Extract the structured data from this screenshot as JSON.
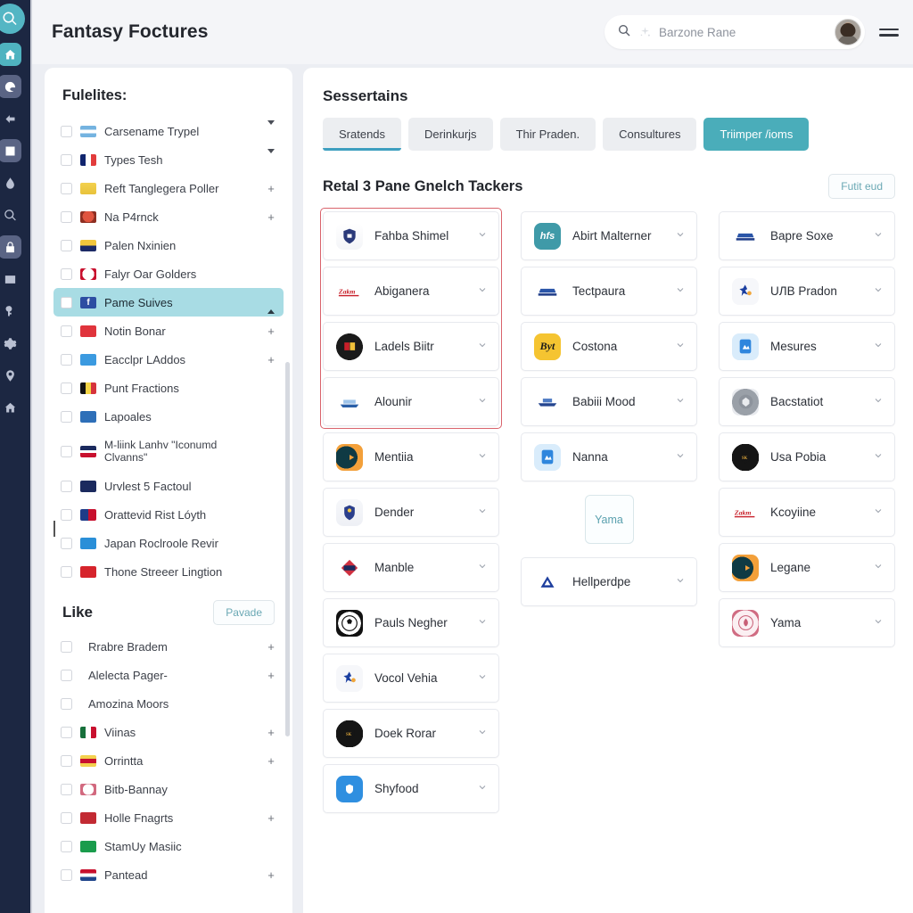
{
  "header": {
    "title": "Fantasy Foctures",
    "search": {
      "value": "Barzone Rane",
      "icon": "search-icon",
      "sparkle_icon": "sparkle-icon"
    },
    "avatar_label": "user-avatar",
    "menu_label": "menu-icon"
  },
  "rail": {
    "items": [
      {
        "name": "search-circle-icon",
        "glyph": "search",
        "style": "accent"
      },
      {
        "name": "home-chip-icon",
        "glyph": "home",
        "style": "chip"
      },
      {
        "name": "edge-icon",
        "glyph": "edge",
        "style": "plain"
      },
      {
        "name": "back-arrow-icon",
        "glyph": "arrow-left",
        "style": "plain"
      },
      {
        "name": "app-window-icon",
        "glyph": "window",
        "style": "plain"
      },
      {
        "name": "droplet-icon",
        "glyph": "droplet",
        "style": "plain"
      },
      {
        "name": "magnifier-icon",
        "glyph": "search",
        "style": "plain"
      },
      {
        "name": "lock-chip-icon",
        "glyph": "lock",
        "style": "chip3"
      },
      {
        "name": "card-icon",
        "glyph": "card",
        "style": "plain"
      },
      {
        "name": "key-icon",
        "glyph": "key",
        "style": "plain"
      },
      {
        "name": "gear-icon",
        "glyph": "gear",
        "style": "plain"
      },
      {
        "name": "pin-icon",
        "glyph": "pin",
        "style": "plain"
      },
      {
        "name": "house-icon",
        "glyph": "house",
        "style": "plain"
      }
    ]
  },
  "left_panel": {
    "title": "Fulelites:",
    "items": [
      {
        "label": "Carsename Trypel",
        "end": "caret-down",
        "flag": "ar"
      },
      {
        "label": "Types Tesh",
        "end": "caret-down",
        "flag": "fr"
      },
      {
        "label": "Reft Tanglegera Poller",
        "end": "+",
        "flag": "badge-gold"
      },
      {
        "label": "Na P4rnck",
        "end": "+",
        "flag": "crest-red"
      },
      {
        "label": "Palen Nxinien",
        "end": "",
        "flag": "ua"
      },
      {
        "label": "Falyr Oar Golders",
        "end": "",
        "flag": "crest-white"
      },
      {
        "label": "Pame Suives",
        "end": "caret-up",
        "flag": "fb",
        "selected": true
      },
      {
        "label": "Notin Bonar",
        "end": "+",
        "flag": "red-badge"
      },
      {
        "label": "Eacclpr LAddos",
        "end": "+",
        "flag": "blue-diamond"
      },
      {
        "label": "Punt Fractions",
        "end": "",
        "flag": "be"
      },
      {
        "label": "Lapoales",
        "end": "",
        "flag": "blue-crest"
      },
      {
        "label": "M-liink Lanhv \"Iconumd Clvanns\"",
        "end": "",
        "flag": "psg",
        "two_line": true
      },
      {
        "label": "Urvlest 5 Factoul",
        "end": "",
        "flag": "navy-badge"
      },
      {
        "label": "Orattevid Rist Lóyth",
        "end": "",
        "flag": "half-circle"
      },
      {
        "label": "Japan Roclroole Revir",
        "end": "",
        "flag": "jp-blue"
      },
      {
        "label": "Thone Streeer Lingtion",
        "end": "",
        "flag": "red-rect"
      }
    ],
    "sub_title": "Like",
    "sub_button": "Pavade",
    "sub_items": [
      {
        "label": "Rrabre Bradem",
        "end": "+",
        "flag": "none"
      },
      {
        "label": "Alelecta Pager-",
        "end": "+",
        "flag": "none"
      },
      {
        "label": "Amozina Moors",
        "end": "",
        "flag": "none"
      },
      {
        "label": "Viinas",
        "end": "+",
        "flag": "mx"
      },
      {
        "label": "Orrintta",
        "end": "+",
        "flag": "es-badge"
      },
      {
        "label": "Bitb-Bannay",
        "end": "",
        "flag": "pink-crest"
      },
      {
        "label": "Holle Fnagrts",
        "end": "+",
        "flag": "red-badge2"
      },
      {
        "label": "StamUy Masiic",
        "end": "",
        "flag": "green-badge"
      },
      {
        "label": "Pantead",
        "end": "+",
        "flag": "nl"
      }
    ]
  },
  "main": {
    "title": "Sessertains",
    "tabs": [
      {
        "label": "Sratends",
        "state": "underline"
      },
      {
        "label": "Derinkurjs",
        "state": "idle"
      },
      {
        "label": "Thir Praden.",
        "state": "idle"
      },
      {
        "label": "Consultures",
        "state": "idle"
      },
      {
        "label": "Triimper /ioms",
        "state": "filled"
      }
    ],
    "section_title": "Retal 3 Pane Gnelch Tackers",
    "section_button": "Futit eud",
    "columns": [
      {
        "name": "column-left",
        "highlight": "box-4",
        "cards": [
          {
            "label": "Fahba Shimel",
            "logo": "crest-navy"
          },
          {
            "label": "Abiganera",
            "logo": "script-red"
          },
          {
            "label": "Ladels Biitr",
            "logo": "black-round"
          },
          {
            "label": "Alounir",
            "logo": "boat-blue"
          },
          {
            "label": "Mentiia",
            "logo": "eagle-teal"
          },
          {
            "label": "Dender",
            "logo": "shield-navy"
          },
          {
            "label": "Manble",
            "logo": "red-diamond"
          },
          {
            "label": "Pauls Negher",
            "logo": "soccer-ball"
          },
          {
            "label": "Vocol Vehia",
            "logo": "bird-blue"
          },
          {
            "label": "Doek Rorar",
            "logo": "black-crest"
          },
          {
            "label": "Shyfood",
            "logo": "blue-square"
          }
        ]
      },
      {
        "name": "column-middle",
        "highlight": "box-1",
        "cards": [
          {
            "label": "Abirt Malterner",
            "logo": "teal-hfs"
          },
          {
            "label": "Tectpaura",
            "logo": "navy-wave"
          },
          {
            "label": "Costona",
            "logo": "yellow-byt"
          },
          {
            "label": "Babiii Mood",
            "logo": "navy-boat"
          },
          {
            "label": "Nanna",
            "logo": "blue-card"
          }
        ],
        "ghost": "Yama",
        "cards_after": [
          {
            "label": "Hellperdpe",
            "logo": "blue-triangle"
          }
        ]
      },
      {
        "name": "column-right",
        "highlight": "none",
        "cards": [
          {
            "label": "Bapre Soxe",
            "logo": "navy-wave"
          },
          {
            "label": "UЛB Pradon",
            "logo": "bird-blue"
          },
          {
            "label": "Mesures",
            "logo": "blue-card"
          },
          {
            "label": "Bacstatiot",
            "logo": "grey-crest"
          },
          {
            "label": "Usa Pobia",
            "logo": "black-crest"
          },
          {
            "label": "Kcoyiine",
            "logo": "script-red"
          },
          {
            "label": "Legane",
            "logo": "eagle-teal"
          },
          {
            "label": "Yama",
            "logo": "pink-round"
          }
        ]
      }
    ]
  }
}
